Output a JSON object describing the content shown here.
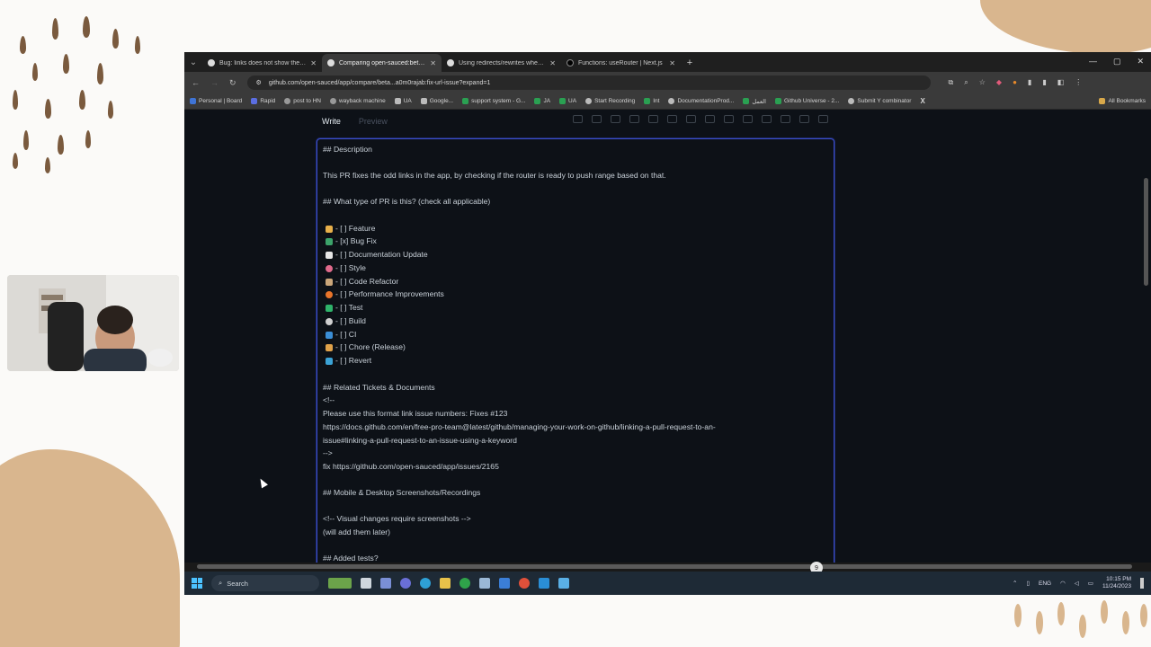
{
  "browser": {
    "tabs": [
      {
        "label": "Bug: links does not show the p...",
        "active": false
      },
      {
        "label": "Comparing open-sauced:beta...",
        "active": true
      },
      {
        "label": "Using redirects/rewrites when...",
        "active": false
      },
      {
        "label": "Functions: useRouter | Next.js",
        "active": false
      }
    ],
    "url": "github.com/open-sauced/app/compare/beta...a0m0rajab:fix-url-issue?expand=1",
    "bookmarks": [
      "Personal | Board",
      "Rapid",
      "post to HN",
      "wayback machine",
      "UA",
      "Google...",
      "support system - G...",
      "JA",
      "UA",
      "Start Recording",
      "Int",
      "DocumentationProd...",
      "العمل",
      "Github Universe - 2...",
      "Submit Y combinator"
    ],
    "all_bookmarks": "All Bookmarks"
  },
  "editor": {
    "write_tab": "Write",
    "preview_tab": "Preview"
  },
  "body_lines": [
    "## Description",
    "This PR fixes the odd links in the app, by checking if the router is ready to push range based on that.",
    "## What type of PR is this? (check all applicable)",
    "- [ ]  Feature",
    "- [x]  Bug Fix",
    "- [ ]  Documentation Update",
    "- [ ]  Style",
    "- [ ]  Code Refactor",
    "- [ ]  Performance Improvements",
    "- [ ]  Test",
    "- [ ]  Build",
    "- [ ]  CI",
    "- [ ]  Chore (Release)",
    "- [ ]  Revert",
    "## Related Tickets & Documents",
    "<!--",
    "Please use this format link issue numbers: Fixes #123",
    "https://docs.github.com/en/free-pro-team@latest/github/managing-your-work-on-github/linking-a-pull-request-to-an-",
    "issue#linking-a-pull-request-to-an-issue-using-a-keyword",
    "-->",
    "fix https://github.com/open-sauced/app/issues/2165",
    "## Mobile & Desktop Screenshots/Recordings",
    "<!-- Visual changes require screenshots -->",
    "(will add them later)",
    "## Added tests?"
  ],
  "taskbar": {
    "search": "Search",
    "lang": "ENG",
    "time": "10:15 PM",
    "date": "11/24/2023"
  },
  "scroll_badge": "9",
  "colors": {
    "page_bg": "#0d1117",
    "textarea_border": "#3b4ec9",
    "accent_tan": "#d9b68e",
    "accent_brown": "#7a5a3e"
  }
}
